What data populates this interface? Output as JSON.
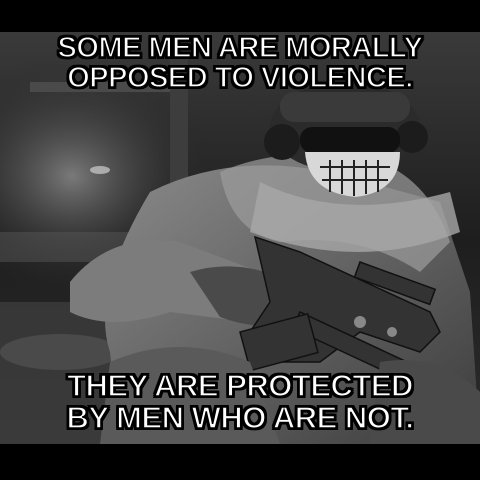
{
  "meme": {
    "top_text": [
      "SOME MEN ARE MORALLY",
      "OPPOSED TO VIOLENCE."
    ],
    "bottom_text": [
      "THEY ARE PROTECTED",
      "BY MEN WHO ARE NOT."
    ]
  },
  "colors": {
    "background": "#000000",
    "text": "#ffffff",
    "outline": "#000000"
  }
}
